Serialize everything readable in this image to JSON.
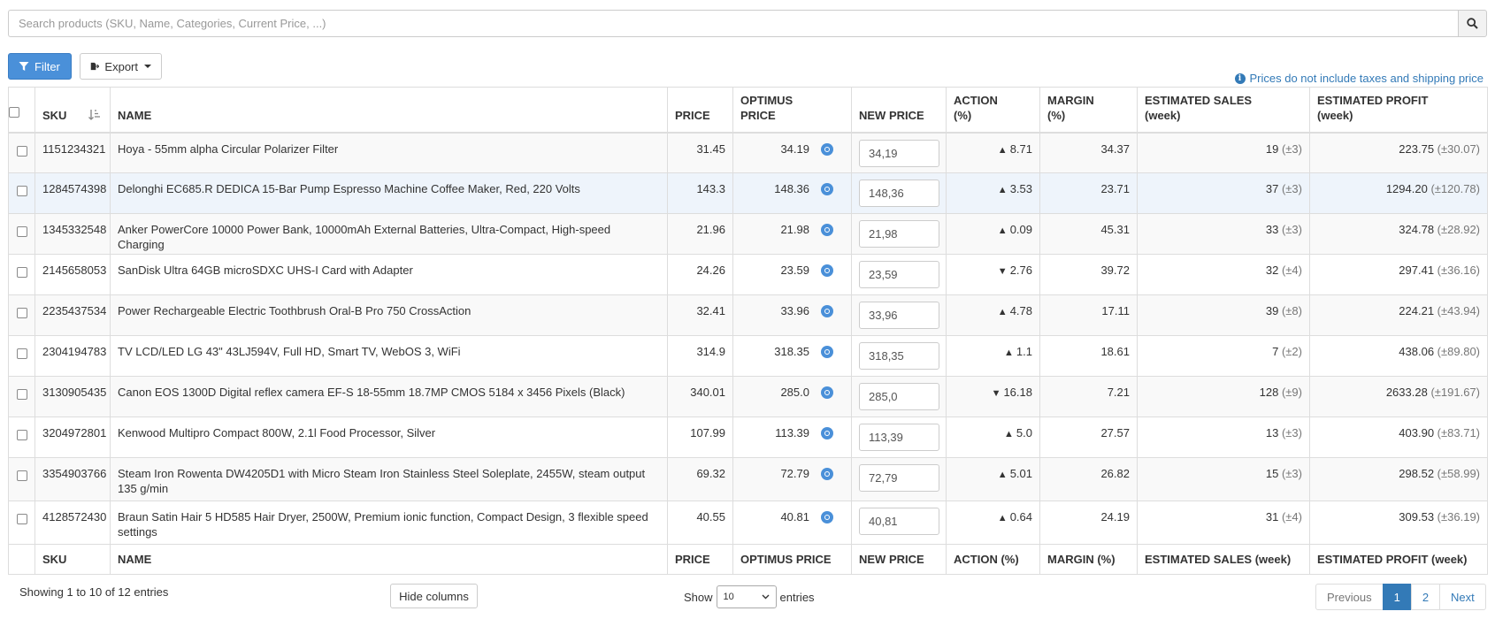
{
  "search": {
    "placeholder": "Search products (SKU, Name, Categories, Current Price, ...)",
    "value": ""
  },
  "toolbar": {
    "filter_label": "Filter",
    "export_label": "Export"
  },
  "note": "Prices do not include taxes and shipping price",
  "columns": {
    "sku": "SKU",
    "name": "NAME",
    "price": "PRICE",
    "optimus_l1": "OPTIMUS",
    "optimus_l2": "PRICE",
    "new_price": "NEW PRICE",
    "action_l1": "ACTION",
    "action_l2": "(%)",
    "margin_l1": "MARGIN",
    "margin_l2": "(%)",
    "sales_l1": "ESTIMATED SALES",
    "sales_l2": "(week)",
    "profit_l1": "ESTIMATED PROFIT",
    "profit_l2": "(week)"
  },
  "footer_columns": {
    "sku": "SKU",
    "name": "NAME",
    "price": "PRICE",
    "optimus": "OPTIMUS PRICE",
    "new_price": "NEW PRICE",
    "action": "ACTION (%)",
    "margin": "MARGIN (%)",
    "sales": "ESTIMATED SALES (week)",
    "profit": "ESTIMATED PROFIT (week)"
  },
  "rows": [
    {
      "sku": "1151234321",
      "name": "Hoya - 55mm alpha Circular Polarizer Filter",
      "price": "31.45",
      "optimus": "34.19",
      "new_price": "34,19",
      "arrow": "▲",
      "action": "8.71",
      "margin": "34.37",
      "sales": "19",
      "sales_var": "(±3)",
      "profit": "223.75",
      "profit_var": "(±30.07)"
    },
    {
      "sku": "1284574398",
      "name": "Delonghi EC685.R DEDICA 15-Bar Pump Espresso Machine Coffee Maker, Red, 220 Volts",
      "price": "143.3",
      "optimus": "148.36",
      "new_price": "148,36",
      "arrow": "▲",
      "action": "3.53",
      "margin": "23.71",
      "sales": "37",
      "sales_var": "(±3)",
      "profit": "1294.20",
      "profit_var": "(±120.78)"
    },
    {
      "sku": "1345332548",
      "name": "Anker PowerCore 10000 Power Bank, 10000mAh External Batteries, Ultra-Compact, High-speed Charging",
      "price": "21.96",
      "optimus": "21.98",
      "new_price": "21,98",
      "arrow": "▲",
      "action": "0.09",
      "margin": "45.31",
      "sales": "33",
      "sales_var": "(±3)",
      "profit": "324.78",
      "profit_var": "(±28.92)"
    },
    {
      "sku": "2145658053",
      "name": "SanDisk Ultra 64GB microSDXC UHS-I Card with Adapter",
      "price": "24.26",
      "optimus": "23.59",
      "new_price": "23,59",
      "arrow": "▼",
      "action": "2.76",
      "margin": "39.72",
      "sales": "32",
      "sales_var": "(±4)",
      "profit": "297.41",
      "profit_var": "(±36.16)"
    },
    {
      "sku": "2235437534",
      "name": "Power Rechargeable Electric Toothbrush Oral-B Pro 750 CrossAction",
      "price": "32.41",
      "optimus": "33.96",
      "new_price": "33,96",
      "arrow": "▲",
      "action": "4.78",
      "margin": "17.11",
      "sales": "39",
      "sales_var": "(±8)",
      "profit": "224.21",
      "profit_var": "(±43.94)"
    },
    {
      "sku": "2304194783",
      "name": "TV LCD/LED LG 43\" 43LJ594V, Full HD, Smart TV, WebOS 3, WiFi",
      "price": "314.9",
      "optimus": "318.35",
      "new_price": "318,35",
      "arrow": "▲",
      "action": "1.1",
      "margin": "18.61",
      "sales": "7",
      "sales_var": "(±2)",
      "profit": "438.06",
      "profit_var": "(±89.80)"
    },
    {
      "sku": "3130905435",
      "name": "Canon EOS 1300D Digital reflex camera EF-S 18-55mm 18.7MP CMOS 5184 x 3456 Pixels (Black)",
      "price": "340.01",
      "optimus": "285.0",
      "new_price": "285,0",
      "arrow": "▼",
      "action": "16.18",
      "margin": "7.21",
      "sales": "128",
      "sales_var": "(±9)",
      "profit": "2633.28",
      "profit_var": "(±191.67)"
    },
    {
      "sku": "3204972801",
      "name": "Kenwood Multipro Compact 800W, 2.1l Food Processor, Silver",
      "price": "107.99",
      "optimus": "113.39",
      "new_price": "113,39",
      "arrow": "▲",
      "action": "5.0",
      "margin": "27.57",
      "sales": "13",
      "sales_var": "(±3)",
      "profit": "403.90",
      "profit_var": "(±83.71)"
    },
    {
      "sku": "3354903766",
      "name": "Steam Iron Rowenta DW4205D1 with Micro Steam Iron Stainless Steel Soleplate, 2455W, steam output 135 g/min",
      "price": "69.32",
      "optimus": "72.79",
      "new_price": "72,79",
      "arrow": "▲",
      "action": "5.01",
      "margin": "26.82",
      "sales": "15",
      "sales_var": "(±3)",
      "profit": "298.52",
      "profit_var": "(±58.99)"
    },
    {
      "sku": "4128572430",
      "name": "Braun Satin Hair 5 HD585 Hair Dryer, 2500W, Premium ionic function, Compact Design, 3 flexible speed settings",
      "price": "40.55",
      "optimus": "40.81",
      "new_price": "40,81",
      "arrow": "▲",
      "action": "0.64",
      "margin": "24.19",
      "sales": "31",
      "sales_var": "(±4)",
      "profit": "309.53",
      "profit_var": "(±36.19)"
    }
  ],
  "info_count": "Showing 1 to 10 of 12 entries",
  "hide_columns_label": "Hide columns",
  "length": {
    "show": "Show",
    "value": "10",
    "entries": "entries"
  },
  "pagination": {
    "previous": "Previous",
    "page1": "1",
    "page2": "2",
    "next": "Next"
  },
  "colors": {
    "accent": "#4a90d9",
    "link": "#337ab7",
    "stripe": "#f9f9f9",
    "hover": "#eef4fb"
  },
  "icons": {
    "search": "search-icon",
    "filter": "filter-icon",
    "export": "export-icon",
    "info": "info-icon",
    "sort": "sort-asc-icon",
    "optimus": "optimus-icon"
  }
}
